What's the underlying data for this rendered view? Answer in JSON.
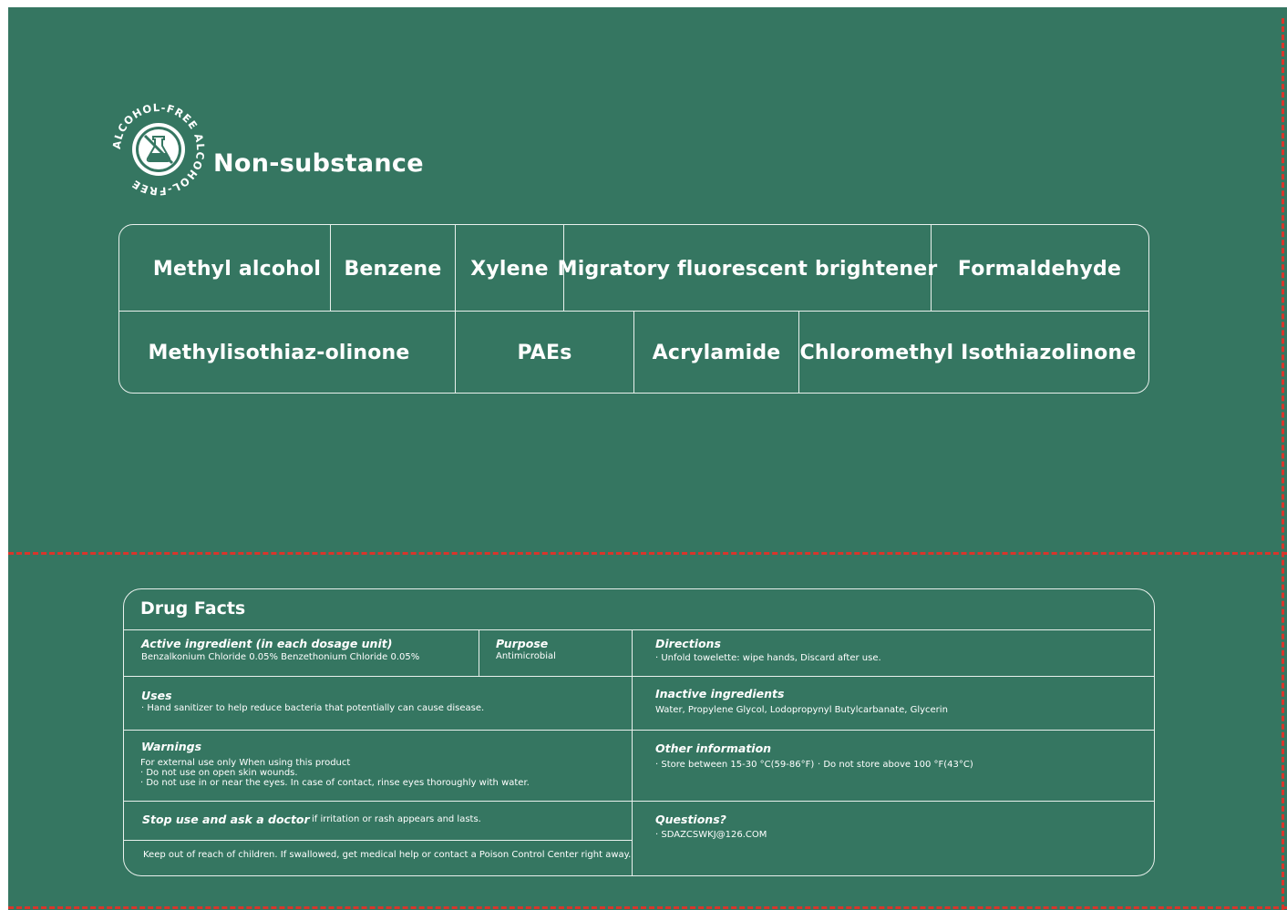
{
  "badge": {
    "ring_text": "ALCOHOL-FREE ALCOHOL-FREE",
    "icon": "crossed-flask-icon"
  },
  "heading": "Non-substance",
  "substances": {
    "row1": [
      "Methyl alcohol",
      "Benzene",
      "Xylene",
      "Migratory fluorescent brightener",
      "Formaldehyde"
    ],
    "row2": [
      "Methylisothiaz-olinone",
      "PAEs",
      "Acrylamide",
      "Chloromethyl Isothiazolinone"
    ]
  },
  "drug_facts": {
    "title": "Drug Facts",
    "active": {
      "heading": "Active ingredient (in each dosage unit)",
      "text": "Benzalkonium Chloride 0.05% Benzethonium Chloride 0.05%"
    },
    "purpose": {
      "heading": "Purpose",
      "text": "Antimicrobial"
    },
    "directions": {
      "heading": "Directions",
      "text": "· Unfold towelette: wipe hands, Discard after use."
    },
    "uses": {
      "heading": "Uses",
      "text": "· Hand sanitizer to help reduce bacteria that potentially can cause disease."
    },
    "inactive": {
      "heading": "Inactive ingredients",
      "text": "Water, Propylene Glycol, Lodopropynyl Butylcarbanate, Glycerin"
    },
    "warnings": {
      "heading": "Warnings",
      "lines": [
        "For external use only When using this product",
        "· Do not use on open skin wounds.",
        "· Do not use in or near the eyes. In case of contact, rinse eyes thoroughly with water."
      ]
    },
    "other": {
      "heading": "Other information",
      "item1": "· Store between 15-30 °C(59-86°F)",
      "item2": "· Do not store above 100 °F(43°C)"
    },
    "stop": {
      "heading": "Stop use and ask a doctor",
      "text": "if irritation or rash appears and lasts."
    },
    "questions": {
      "heading": "Questions?",
      "text": "· SDAZCSWKJ@126.COM"
    },
    "keep_out": "Keep out of reach of children. If swallowed, get medical help or contact a Poison Control Center right away."
  },
  "colors": {
    "background": "#357661",
    "line": "#e9f1ed",
    "cut_line": "#d9352b"
  }
}
